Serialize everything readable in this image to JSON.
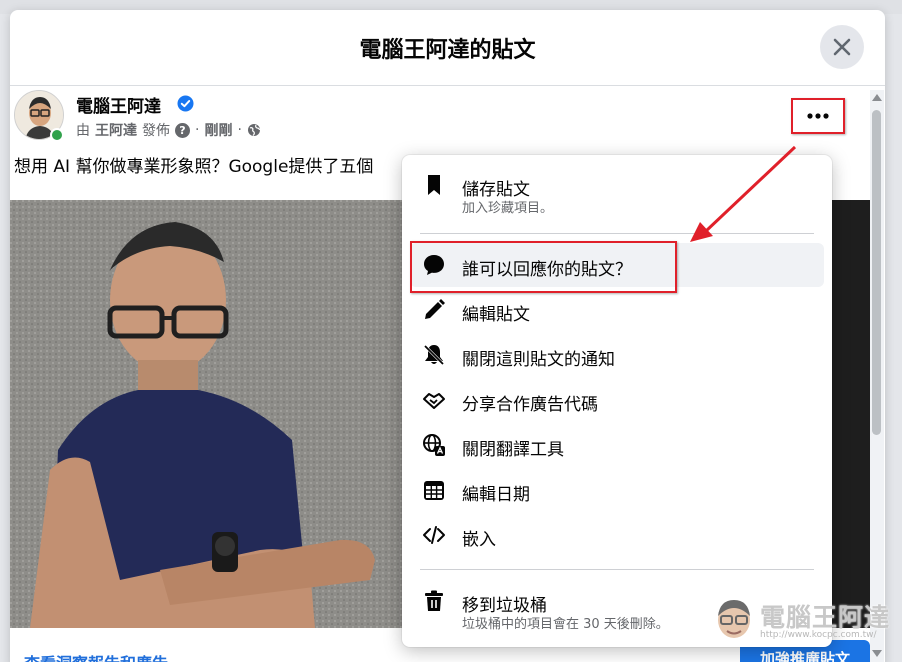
{
  "modal": {
    "title": "電腦王阿達的貼文",
    "close_icon": "close-icon"
  },
  "post": {
    "author": "電腦王阿達",
    "by_label": "由",
    "publisher": "王阿達",
    "published_label": "發佈",
    "time": "剛剛",
    "text": "想用 AI 幫你做專業形象照？Google提供了五個",
    "insight_link": "查看洞察報告和廣告",
    "boost_button": "加強推廣貼文"
  },
  "menu": {
    "items": [
      {
        "icon": "bookmark-icon",
        "label": "儲存貼文",
        "sub": "加入珍藏項目。"
      },
      {
        "icon": "comment-icon",
        "label": "誰可以回應你的貼文？"
      },
      {
        "icon": "pencil-icon",
        "label": "編輯貼文"
      },
      {
        "icon": "bell-off-icon",
        "label": "關閉這則貼文的通知"
      },
      {
        "icon": "handshake-icon",
        "label": "分享合作廣告代碼"
      },
      {
        "icon": "globe-translate-icon",
        "label": "關閉翻譯工具"
      },
      {
        "icon": "calendar-icon",
        "label": "編輯日期"
      },
      {
        "icon": "code-icon",
        "label": "嵌入"
      },
      {
        "icon": "trash-icon",
        "label": "移到垃圾桶",
        "sub": "垃圾桶中的項目會在 30 天後刪除。"
      }
    ]
  },
  "watermark": {
    "text": "電腦王阿達",
    "url": "http://www.kocpc.com.tw/"
  },
  "colors": {
    "accent": "#1b74e4",
    "highlight_border": "#e0202a",
    "verified": "#1877f2",
    "online": "#31a24c"
  }
}
